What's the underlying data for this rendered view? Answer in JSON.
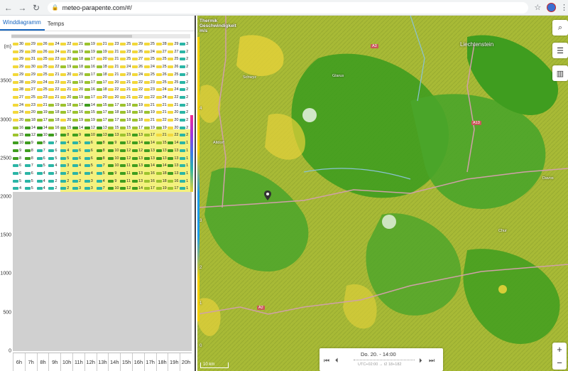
{
  "browser": {
    "url": "meteo-parapente.com/#/",
    "back_icon": "arrow-left-icon",
    "forward_icon": "arrow-right-icon",
    "reload_icon": "reload-icon"
  },
  "left_panel": {
    "tabs": [
      {
        "label": "Winddiagramm",
        "active": true
      },
      {
        "label": "Temps",
        "active": false
      }
    ],
    "unit": "(m)",
    "y_ticks": [
      "3500",
      "3000",
      "2500",
      "2000",
      "1500",
      "1000",
      "500",
      "0"
    ],
    "hours": [
      "6h",
      "7h",
      "8h",
      "9h",
      "10h",
      "11h",
      "12h",
      "13h",
      "14h",
      "15h",
      "16h",
      "17h",
      "18h",
      "19h",
      "20h"
    ],
    "wind_rows": [
      [
        "30",
        "29",
        "26",
        "24",
        "22",
        "21",
        "19",
        "21",
        "23",
        "25",
        "29",
        "25",
        "28",
        "29",
        "3"
      ],
      [
        "29",
        "28",
        "26",
        "24",
        "21",
        "19",
        "19",
        "19",
        "21",
        "23",
        "26",
        "24",
        "27",
        "27",
        "2"
      ],
      [
        "29",
        "31",
        "25",
        "23",
        "20",
        "18",
        "17",
        "20",
        "21",
        "25",
        "27",
        "25",
        "25",
        "25",
        "2"
      ],
      [
        "29",
        "30",
        "25",
        "22",
        "19",
        "18",
        "16",
        "18",
        "21",
        "24",
        "26",
        "24",
        "25",
        "26",
        "2"
      ],
      [
        "29",
        "29",
        "25",
        "21",
        "20",
        "20",
        "17",
        "18",
        "21",
        "23",
        "24",
        "25",
        "26",
        "25",
        "2"
      ],
      [
        "28",
        "29",
        "24",
        "23",
        "21",
        "19",
        "17",
        "17",
        "20",
        "21",
        "22",
        "23",
        "25",
        "25",
        "2"
      ],
      [
        "28",
        "27",
        "25",
        "22",
        "21",
        "20",
        "16",
        "18",
        "22",
        "21",
        "22",
        "23",
        "24",
        "24",
        "2"
      ],
      [
        "27",
        "25",
        "23",
        "21",
        "20",
        "19",
        "17",
        "20",
        "20",
        "21",
        "22",
        "22",
        "24",
        "22",
        "2"
      ],
      [
        "24",
        "23",
        "21",
        "19",
        "18",
        "17",
        "14",
        "15",
        "17",
        "18",
        "19",
        "21",
        "21",
        "21",
        "2"
      ],
      [
        "24",
        "20",
        "19",
        "18",
        "17",
        "16",
        "15",
        "17",
        "18",
        "18",
        "18",
        "19",
        "21",
        "20",
        "2"
      ],
      [
        "20",
        "18",
        "17",
        "18",
        "20",
        "19",
        "19",
        "17",
        "17",
        "18",
        "18",
        "21",
        "22",
        "20",
        "2"
      ],
      [
        "16",
        "14",
        "14",
        "16",
        "15",
        "14",
        "12",
        "13",
        "15",
        "15",
        "17",
        "19",
        "19",
        "20",
        "2"
      ],
      [
        "15",
        "12",
        "10",
        "9",
        "8",
        "9",
        "10",
        "13",
        "13",
        "15",
        "13",
        "17",
        "21",
        "22",
        "2"
      ],
      [
        "10",
        "9",
        "8",
        "7",
        "4",
        "5",
        "6",
        "8",
        "9",
        "12",
        "14",
        "14",
        "15",
        "14",
        "1"
      ],
      [
        "9",
        "8",
        "7",
        "6",
        "4",
        "6",
        "6",
        "8",
        "10",
        "12",
        "12",
        "13",
        "13",
        "13",
        "1"
      ],
      [
        "8",
        "8",
        "6",
        "5",
        "5",
        "6",
        "6",
        "8",
        "10",
        "12",
        "13",
        "13",
        "13",
        "13",
        "1"
      ],
      [
        "6",
        "7",
        "5",
        "4",
        "3",
        "4",
        "5",
        "7",
        "10",
        "11",
        "13",
        "14",
        "14",
        "13",
        "1"
      ],
      [
        "6",
        "6",
        "4",
        "3",
        "2",
        "4",
        "4",
        "5",
        "9",
        "11",
        "13",
        "16",
        "18",
        "13",
        "1"
      ],
      [
        "5",
        "5",
        "4",
        "2",
        "2",
        "2",
        "3",
        "4",
        "9",
        "11",
        "13",
        "16",
        "18",
        "16",
        "1"
      ],
      [
        "4",
        "5",
        "4",
        "2",
        "2",
        "3",
        "3",
        "7",
        "10",
        "12",
        "14",
        "17",
        "19",
        "17",
        "1"
      ]
    ]
  },
  "map": {
    "legend_title": [
      "Thermik",
      "Geschwindigkeit",
      "m/s"
    ],
    "legend_numbers": [
      "4",
      "3",
      "2",
      "1",
      "0"
    ],
    "search_icon": "search-icon",
    "settings_icon": "sliders-icon",
    "chart_icon": "bar-chart-icon",
    "zoom_in": "+",
    "zoom_out": "−",
    "scale": "10 km",
    "time_label": "Do. 20. - 14:00",
    "utc_label": "UTC+02:00 → t2 18+182",
    "place_labels": [
      "Liechtenstein",
      "Schwyz",
      "Glarus",
      "Altdorf",
      "Chur",
      "Davos",
      "A13",
      "A2",
      "A3"
    ],
    "colors": {
      "yellow": "#e6d23a",
      "green": "#3f9d1f",
      "lime": "#9bb62f"
    }
  }
}
